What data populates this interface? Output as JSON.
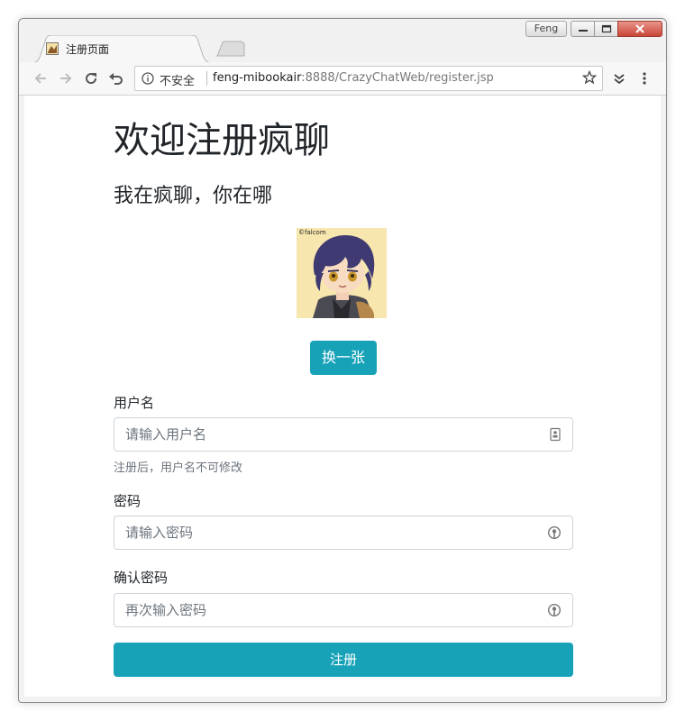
{
  "window": {
    "user": "Feng"
  },
  "tab": {
    "title": "注册页面"
  },
  "address_bar": {
    "security_label": "不安全",
    "url_host": "feng-mibookair",
    "url_rest": ":8888/CrazyChatWeb/register.jsp"
  },
  "page": {
    "heading": "欢迎注册疯聊",
    "subheading": "我在疯聊，你在哪",
    "avatar_credit": "©falcom",
    "change_avatar_label": "换一张",
    "username": {
      "label": "用户名",
      "placeholder": "请输入用户名",
      "help": "注册后，用户名不可修改"
    },
    "password": {
      "label": "密码",
      "placeholder": "请输入密码"
    },
    "confirm_password": {
      "label": "确认密码",
      "placeholder": "再次输入密码"
    },
    "submit_label": "注册"
  },
  "colors": {
    "primary": "#17a2b8",
    "text": "#212529",
    "muted": "#6c757d"
  }
}
